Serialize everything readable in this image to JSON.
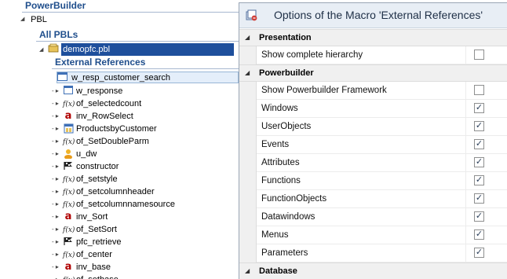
{
  "tree": {
    "header": "PowerBuilder",
    "pbl_label": "PBL",
    "all_pbls": "All PBLs",
    "pbl_file": "demopfc.pbl",
    "ext_refs_header": "External References",
    "selected_item": "w_resp_customer_search",
    "children": [
      {
        "label": "w_response",
        "icon": "window-icon"
      },
      {
        "label": "of_selectedcount",
        "icon": "function-icon"
      },
      {
        "label": "inv_RowSelect",
        "icon": "userobject-icon"
      },
      {
        "label": "ProductsbyCustomer",
        "icon": "datawindow-icon"
      },
      {
        "label": "of_SetDoubleParm",
        "icon": "function-icon"
      },
      {
        "label": "u_dw",
        "icon": "user-icon"
      },
      {
        "label": "constructor",
        "icon": "event-icon"
      },
      {
        "label": "of_setstyle",
        "icon": "function-icon"
      },
      {
        "label": "of_setcolumnheader",
        "icon": "function-icon"
      },
      {
        "label": "of_setcolumnnamesource",
        "icon": "function-icon"
      },
      {
        "label": "inv_Sort",
        "icon": "userobject-icon"
      },
      {
        "label": "of_SetSort",
        "icon": "function-icon"
      },
      {
        "label": "pfc_retrieve",
        "icon": "event-icon"
      },
      {
        "label": "of_center",
        "icon": "function-icon"
      },
      {
        "label": "inv_base",
        "icon": "userobject-icon"
      },
      {
        "label": "of_setbase",
        "icon": "function-icon"
      }
    ]
  },
  "dialog": {
    "title": "Options of the Macro 'External References'",
    "sections": [
      {
        "name": "Presentation",
        "options": [
          {
            "label": "Show complete hierarchy",
            "checked": false
          }
        ]
      },
      {
        "name": "Powerbuilder",
        "options": [
          {
            "label": "Show Powerbuilder Framework",
            "checked": false
          },
          {
            "label": "Windows",
            "checked": true
          },
          {
            "label": "UserObjects",
            "checked": true
          },
          {
            "label": "Events",
            "checked": true
          },
          {
            "label": "Attributes",
            "checked": true
          },
          {
            "label": "Functions",
            "checked": true
          },
          {
            "label": "FunctionObjects",
            "checked": true
          },
          {
            "label": "Datawindows",
            "checked": true
          },
          {
            "label": "Menus",
            "checked": true
          },
          {
            "label": "Parameters",
            "checked": true
          }
        ]
      },
      {
        "name": "Database",
        "options": []
      }
    ]
  },
  "colors": {
    "header_blue": "#1f4e8c",
    "selection": "#1e4f9c",
    "inv_red": "#b00000"
  }
}
